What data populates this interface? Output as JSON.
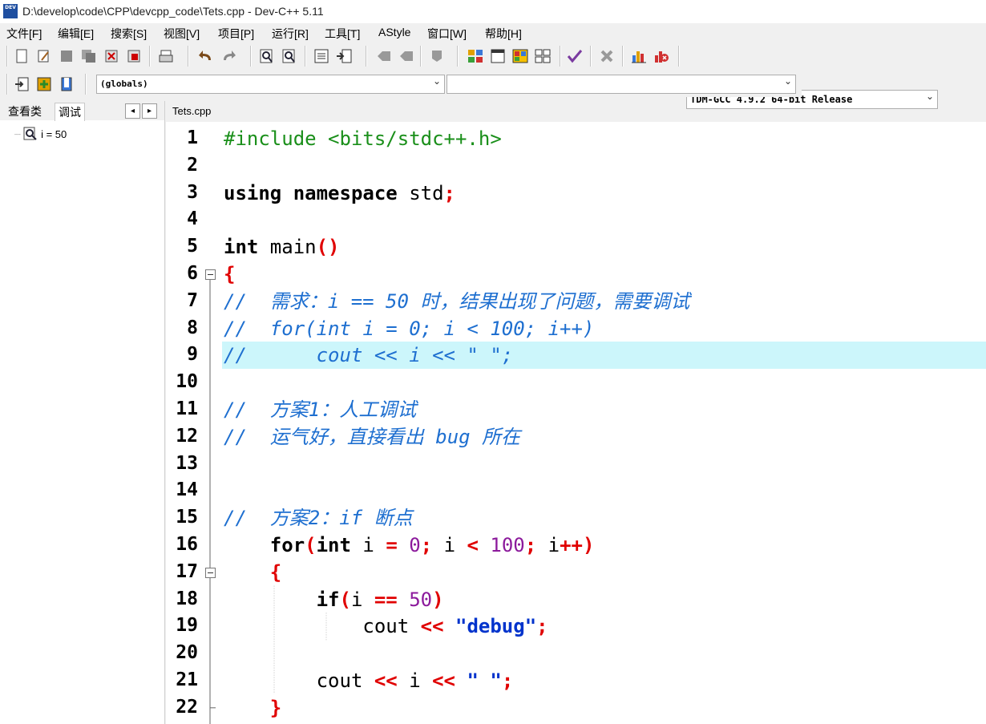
{
  "window": {
    "title": "D:\\develop\\code\\CPP\\devcpp_code\\Tets.cpp - Dev-C++ 5.11",
    "icon_text": "DEV"
  },
  "menu": [
    {
      "label": "文件[F]"
    },
    {
      "label": "编辑[E]"
    },
    {
      "label": "搜索[S]"
    },
    {
      "label": "视图[V]"
    },
    {
      "label": "项目[P]"
    },
    {
      "label": "运行[R]"
    },
    {
      "label": "工具[T]"
    },
    {
      "label": "AStyle"
    },
    {
      "label": "窗口[W]"
    },
    {
      "label": "帮助[H]"
    }
  ],
  "toolbar": {
    "compiler_select": "TDM-GCC 4.9.2 64-bit Release",
    "scope_select": "(globals)",
    "function_select": ""
  },
  "left_panel": {
    "tabs": [
      "查看类",
      "调试"
    ],
    "active_tab": "调试",
    "nav_left": "◂",
    "nav_right": "▸",
    "watch_item": "i = 50"
  },
  "editor": {
    "file_tab": "Tets.cpp",
    "highlight_color": "#ccf6fb",
    "lines": [
      {
        "n": "1",
        "segs": [
          {
            "t": "#include <bits/stdc++.h>",
            "c": "pre"
          }
        ]
      },
      {
        "n": "2",
        "segs": []
      },
      {
        "n": "3",
        "segs": [
          {
            "t": "using namespace ",
            "c": "kw"
          },
          {
            "t": "std",
            "c": "plain"
          },
          {
            "t": ";",
            "c": "op"
          }
        ]
      },
      {
        "n": "4",
        "segs": []
      },
      {
        "n": "5",
        "segs": [
          {
            "t": "int ",
            "c": "kw"
          },
          {
            "t": "main",
            "c": "plain"
          },
          {
            "t": "()",
            "c": "op"
          }
        ]
      },
      {
        "n": "6",
        "fold": true,
        "segs": [
          {
            "t": "{",
            "c": "op"
          }
        ]
      },
      {
        "n": "7",
        "segs": [
          {
            "t": "//  需求：i == 50 时，结果出现了问题，需要调试",
            "c": "cm"
          }
        ]
      },
      {
        "n": "8",
        "segs": [
          {
            "t": "//  for(int i = 0; i < 100; i++)",
            "c": "cm"
          }
        ]
      },
      {
        "n": "9",
        "hl": true,
        "segs": [
          {
            "t": "//      cout << i << \" \";",
            "c": "cm"
          }
        ]
      },
      {
        "n": "10",
        "segs": []
      },
      {
        "n": "11",
        "segs": [
          {
            "t": "//  方案1：人工调试",
            "c": "cm"
          }
        ]
      },
      {
        "n": "12",
        "segs": [
          {
            "t": "//  运气好，直接看出 bug 所在",
            "c": "cm"
          }
        ]
      },
      {
        "n": "13",
        "segs": []
      },
      {
        "n": "14",
        "segs": []
      },
      {
        "n": "15",
        "segs": [
          {
            "t": "//  方案2：if 断点",
            "c": "cm"
          }
        ]
      },
      {
        "n": "16",
        "segs": [
          {
            "t": "    ",
            "c": "plain"
          },
          {
            "t": "for",
            "c": "kw"
          },
          {
            "t": "(",
            "c": "op"
          },
          {
            "t": "int ",
            "c": "kw"
          },
          {
            "t": "i ",
            "c": "plain"
          },
          {
            "t": "= ",
            "c": "op"
          },
          {
            "t": "0",
            "c": "num"
          },
          {
            "t": "; ",
            "c": "op"
          },
          {
            "t": "i ",
            "c": "plain"
          },
          {
            "t": "< ",
            "c": "op"
          },
          {
            "t": "100",
            "c": "num"
          },
          {
            "t": "; ",
            "c": "op"
          },
          {
            "t": "i",
            "c": "plain"
          },
          {
            "t": "++)",
            "c": "op"
          }
        ]
      },
      {
        "n": "17",
        "fold": true,
        "segs": [
          {
            "t": "    ",
            "c": "plain"
          },
          {
            "t": "{",
            "c": "op"
          }
        ]
      },
      {
        "n": "18",
        "segs": [
          {
            "t": "        ",
            "c": "plain"
          },
          {
            "t": "if",
            "c": "kw"
          },
          {
            "t": "(",
            "c": "op"
          },
          {
            "t": "i ",
            "c": "plain"
          },
          {
            "t": "== ",
            "c": "op"
          },
          {
            "t": "50",
            "c": "num"
          },
          {
            "t": ")",
            "c": "op"
          }
        ]
      },
      {
        "n": "19",
        "segs": [
          {
            "t": "            ",
            "c": "plain"
          },
          {
            "t": "cout ",
            "c": "plain"
          },
          {
            "t": "<< ",
            "c": "op"
          },
          {
            "t": "\"debug\"",
            "c": "str"
          },
          {
            "t": ";",
            "c": "op"
          }
        ]
      },
      {
        "n": "20",
        "segs": []
      },
      {
        "n": "21",
        "segs": [
          {
            "t": "        ",
            "c": "plain"
          },
          {
            "t": "cout ",
            "c": "plain"
          },
          {
            "t": "<< ",
            "c": "op"
          },
          {
            "t": "i ",
            "c": "plain"
          },
          {
            "t": "<< ",
            "c": "op"
          },
          {
            "t": "\" \"",
            "c": "str"
          },
          {
            "t": ";",
            "c": "op"
          }
        ]
      },
      {
        "n": "22",
        "segs": [
          {
            "t": "    ",
            "c": "plain"
          },
          {
            "t": "}",
            "c": "op"
          }
        ]
      }
    ]
  }
}
